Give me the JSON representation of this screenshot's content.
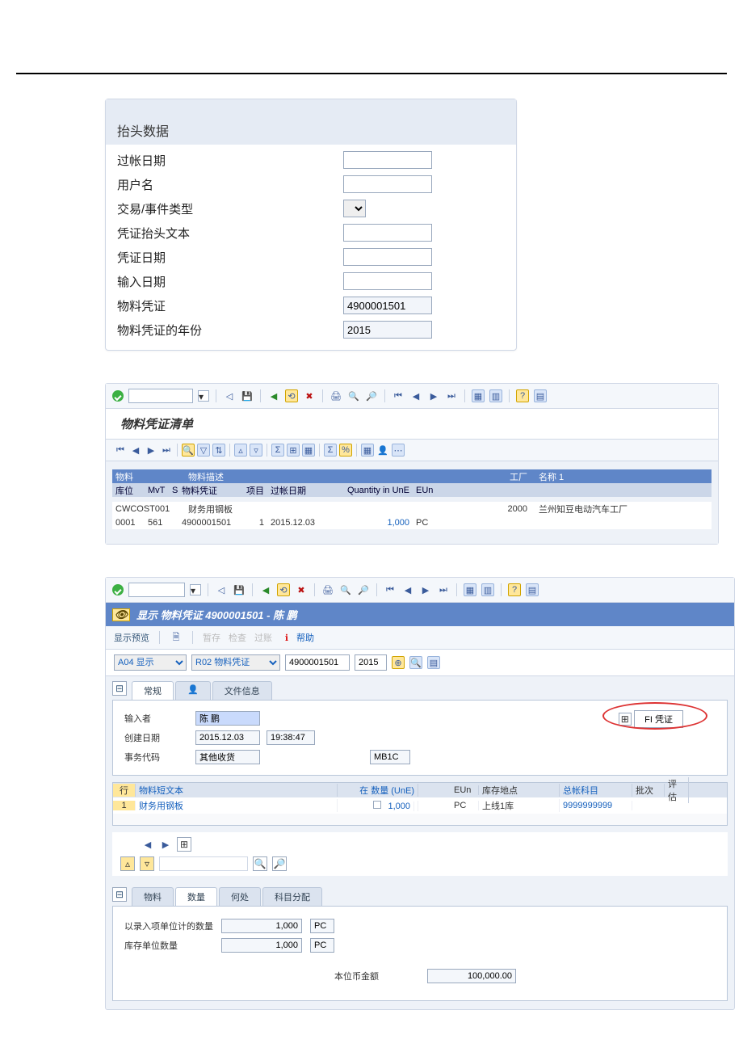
{
  "panel1": {
    "title": "抬头数据",
    "labels": {
      "posting_date": "过帐日期",
      "user": "用户名",
      "event_type": "交易/事件类型",
      "header_text": "凭证抬头文本",
      "doc_date": "凭证日期",
      "entry_date": "输入日期",
      "mat_doc": "物料凭证",
      "mat_doc_year": "物料凭证的年份"
    },
    "values": {
      "posting_date": "",
      "user": "",
      "event_type": "",
      "header_text": "",
      "doc_date": "",
      "entry_date": "",
      "mat_doc": "4900001501",
      "mat_doc_year": "2015"
    }
  },
  "panel2": {
    "subtitle": "物料凭证清单",
    "header": {
      "c_mat": "物料",
      "c_desc": "物料描述",
      "c_plant": "工厂",
      "c_name": "名称 1"
    },
    "subheader": {
      "c_sloc": "库位",
      "c_mvt": "MvT",
      "c_s": "S",
      "c_doc": "物料凭证",
      "c_item": "项目",
      "c_pd": "过帐日期",
      "c_qty": "Quantity in UnE",
      "c_un": "EUn"
    },
    "row1": {
      "mat": "CWCOST001",
      "desc": "财务用钢板",
      "plant": "2000",
      "name": "兰州知豆电动汽车工厂"
    },
    "row2": {
      "sloc": "0001",
      "mvt": "561",
      "s": "",
      "doc": "4900001501",
      "item": "1",
      "pd": "2015.12.03",
      "qty": "1,000",
      "un": "PC"
    }
  },
  "panel3": {
    "title_prefix": "显示 物料凭证 4900001501 - 陈 鹏",
    "actions": {
      "overview": "显示预览",
      "hold": "暂存",
      "check": "检查",
      "post": "过账",
      "help": "帮助"
    },
    "pickers": {
      "a04": "A04 显示",
      "r02": "R02 物料凭证",
      "doc": "4900001501",
      "year": "2015"
    },
    "tabs_top": {
      "general": "常规",
      "vendor_icon": "👤",
      "fileinfo": "文件信息"
    },
    "general": {
      "entered_by_lbl": "输入者",
      "entered_by": "陈 鹏",
      "created_lbl": "创建日期",
      "created": "2015.12.03",
      "created_time": "19:38:47",
      "tcode_lbl": "事务代码",
      "tcode": "其他收货",
      "tcode_code": "MB1C",
      "fi_btn": "FI 凭证"
    },
    "grid": {
      "h_line": "行",
      "h_txt": "物料短文本",
      "h_qty": "在 数量 (UnE)",
      "h_un": "EUn",
      "h_sloc": "库存地点",
      "h_acct": "总帐科目",
      "h_batch": "批次",
      "h_eval": "评估",
      "r_line": "1",
      "r_txt": "财务用钢板",
      "r_qty": "1,000",
      "r_un": "PC",
      "r_sloc": "上线1库",
      "r_acct": "9999999999"
    },
    "tabs_bot": {
      "material": "物料",
      "qty": "数量",
      "where": "何处",
      "acct": "科目分配"
    },
    "qty_pane": {
      "row1_lbl": "以录入项单位计的数量",
      "row1_val": "1,000",
      "row1_un": "PC",
      "row2_lbl": "库存单位数量",
      "row2_val": "1,000",
      "row2_un": "PC",
      "amt_lbl": "本位币金额",
      "amt_val": "100,000.00"
    }
  }
}
